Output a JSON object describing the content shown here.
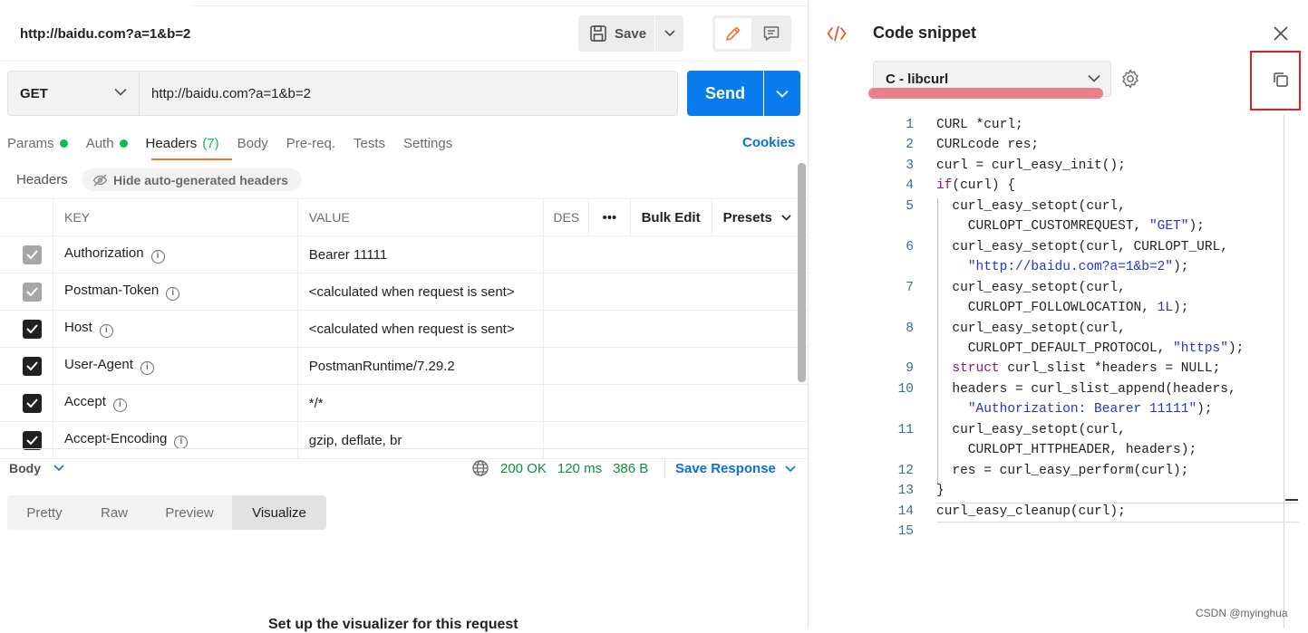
{
  "request": {
    "title": "http://baidu.com?a=1&b=2",
    "save_label": "Save",
    "method": "GET",
    "url": "http://baidu.com?a=1&b=2",
    "send_label": "Send"
  },
  "tabs": [
    {
      "label": "Params",
      "dot": true
    },
    {
      "label": "Auth",
      "dot": true
    },
    {
      "label": "Headers",
      "count": "(7)",
      "active": true
    },
    {
      "label": "Body"
    },
    {
      "label": "Pre-req."
    },
    {
      "label": "Tests"
    },
    {
      "label": "Settings"
    }
  ],
  "cookies_label": "Cookies",
  "headers_section": {
    "label": "Headers",
    "hide_button": "Hide auto-generated headers",
    "columns": {
      "key": "KEY",
      "value": "VALUE",
      "desc": "DES",
      "more": "•••",
      "bulk_edit": "Bulk Edit",
      "presets": "Presets"
    },
    "rows": [
      {
        "key": "Authorization",
        "value": "Bearer 11111",
        "checked": true,
        "disabled": true
      },
      {
        "key": "Postman-Token",
        "value": "<calculated when request is sent>",
        "checked": true,
        "disabled": true
      },
      {
        "key": "Host",
        "value": "<calculated when request is sent>",
        "checked": true,
        "disabled": false
      },
      {
        "key": "User-Agent",
        "value": "PostmanRuntime/7.29.2",
        "checked": true,
        "disabled": false
      },
      {
        "key": "Accept",
        "value": "*/*",
        "checked": true,
        "disabled": false
      },
      {
        "key": "Accept-Encoding",
        "value": "gzip, deflate, br",
        "checked": true,
        "disabled": false
      }
    ]
  },
  "response": {
    "body_label": "Body",
    "status": "200 OK",
    "time": "120 ms",
    "size": "386 B",
    "save_response": "Save Response",
    "view_tabs": [
      "Pretty",
      "Raw",
      "Preview",
      "Visualize"
    ],
    "active_view": "Visualize",
    "visualizer_text": "Set up the visualizer for this request"
  },
  "snippet": {
    "title": "Code snippet",
    "language": "C - libcurl",
    "lines": [
      {
        "n": "1",
        "html": "CURL *curl;"
      },
      {
        "n": "2",
        "html": "CURLcode res;"
      },
      {
        "n": "3",
        "html": "curl = curl_easy_init();"
      },
      {
        "n": "4",
        "html": "<span class='kw'>if</span>(curl) {"
      },
      {
        "n": "5",
        "html": "  curl_easy_setopt(curl,"
      },
      {
        "n": "",
        "html": "    CURLOPT_CUSTOMREQUEST, <span class='str'>\"GET\"</span>);"
      },
      {
        "n": "6",
        "html": "  curl_easy_setopt(curl, CURLOPT_URL,"
      },
      {
        "n": "",
        "html": "    <span class='str'>\"http://baidu.com?a=1&amp;b=2\"</span>);"
      },
      {
        "n": "7",
        "html": "  curl_easy_setopt(curl,"
      },
      {
        "n": "",
        "html": "    CURLOPT_FOLLOWLOCATION, <span class='num'>1L</span>);"
      },
      {
        "n": "8",
        "html": "  curl_easy_setopt(curl,"
      },
      {
        "n": "",
        "html": "    CURLOPT_DEFAULT_PROTOCOL, <span class='str'>\"https\"</span>);"
      },
      {
        "n": "9",
        "html": "  <span class='kw'>struct</span> curl_slist *headers = NULL;"
      },
      {
        "n": "10",
        "html": "  headers = curl_slist_append(headers,"
      },
      {
        "n": "",
        "html": "    <span class='str'>\"Authorization: Bearer 11111\"</span>);"
      },
      {
        "n": "11",
        "html": "  curl_easy_setopt(curl,"
      },
      {
        "n": "",
        "html": "    CURLOPT_HTTPHEADER, headers);"
      },
      {
        "n": "12",
        "html": "  res = curl_easy_perform(curl);"
      },
      {
        "n": "13",
        "html": "}"
      },
      {
        "n": "14",
        "html": "curl_easy_cleanup(curl);"
      },
      {
        "n": "15",
        "html": ""
      }
    ]
  },
  "watermark": "CSDN @myinghua",
  "colors": {
    "send": "#097bed",
    "accent": "#ff6c37",
    "ok": "#0cbb52",
    "link": "#0b6fd4",
    "highlight_box": "#e02020"
  },
  "icons": [
    "floppy-disk-icon",
    "chevron-down-icon",
    "pencil-icon",
    "comment-icon",
    "info-icon",
    "eye-off-icon",
    "globe-icon",
    "code-icon",
    "close-icon",
    "gear-icon",
    "copy-icon",
    "checkmark-icon"
  ]
}
